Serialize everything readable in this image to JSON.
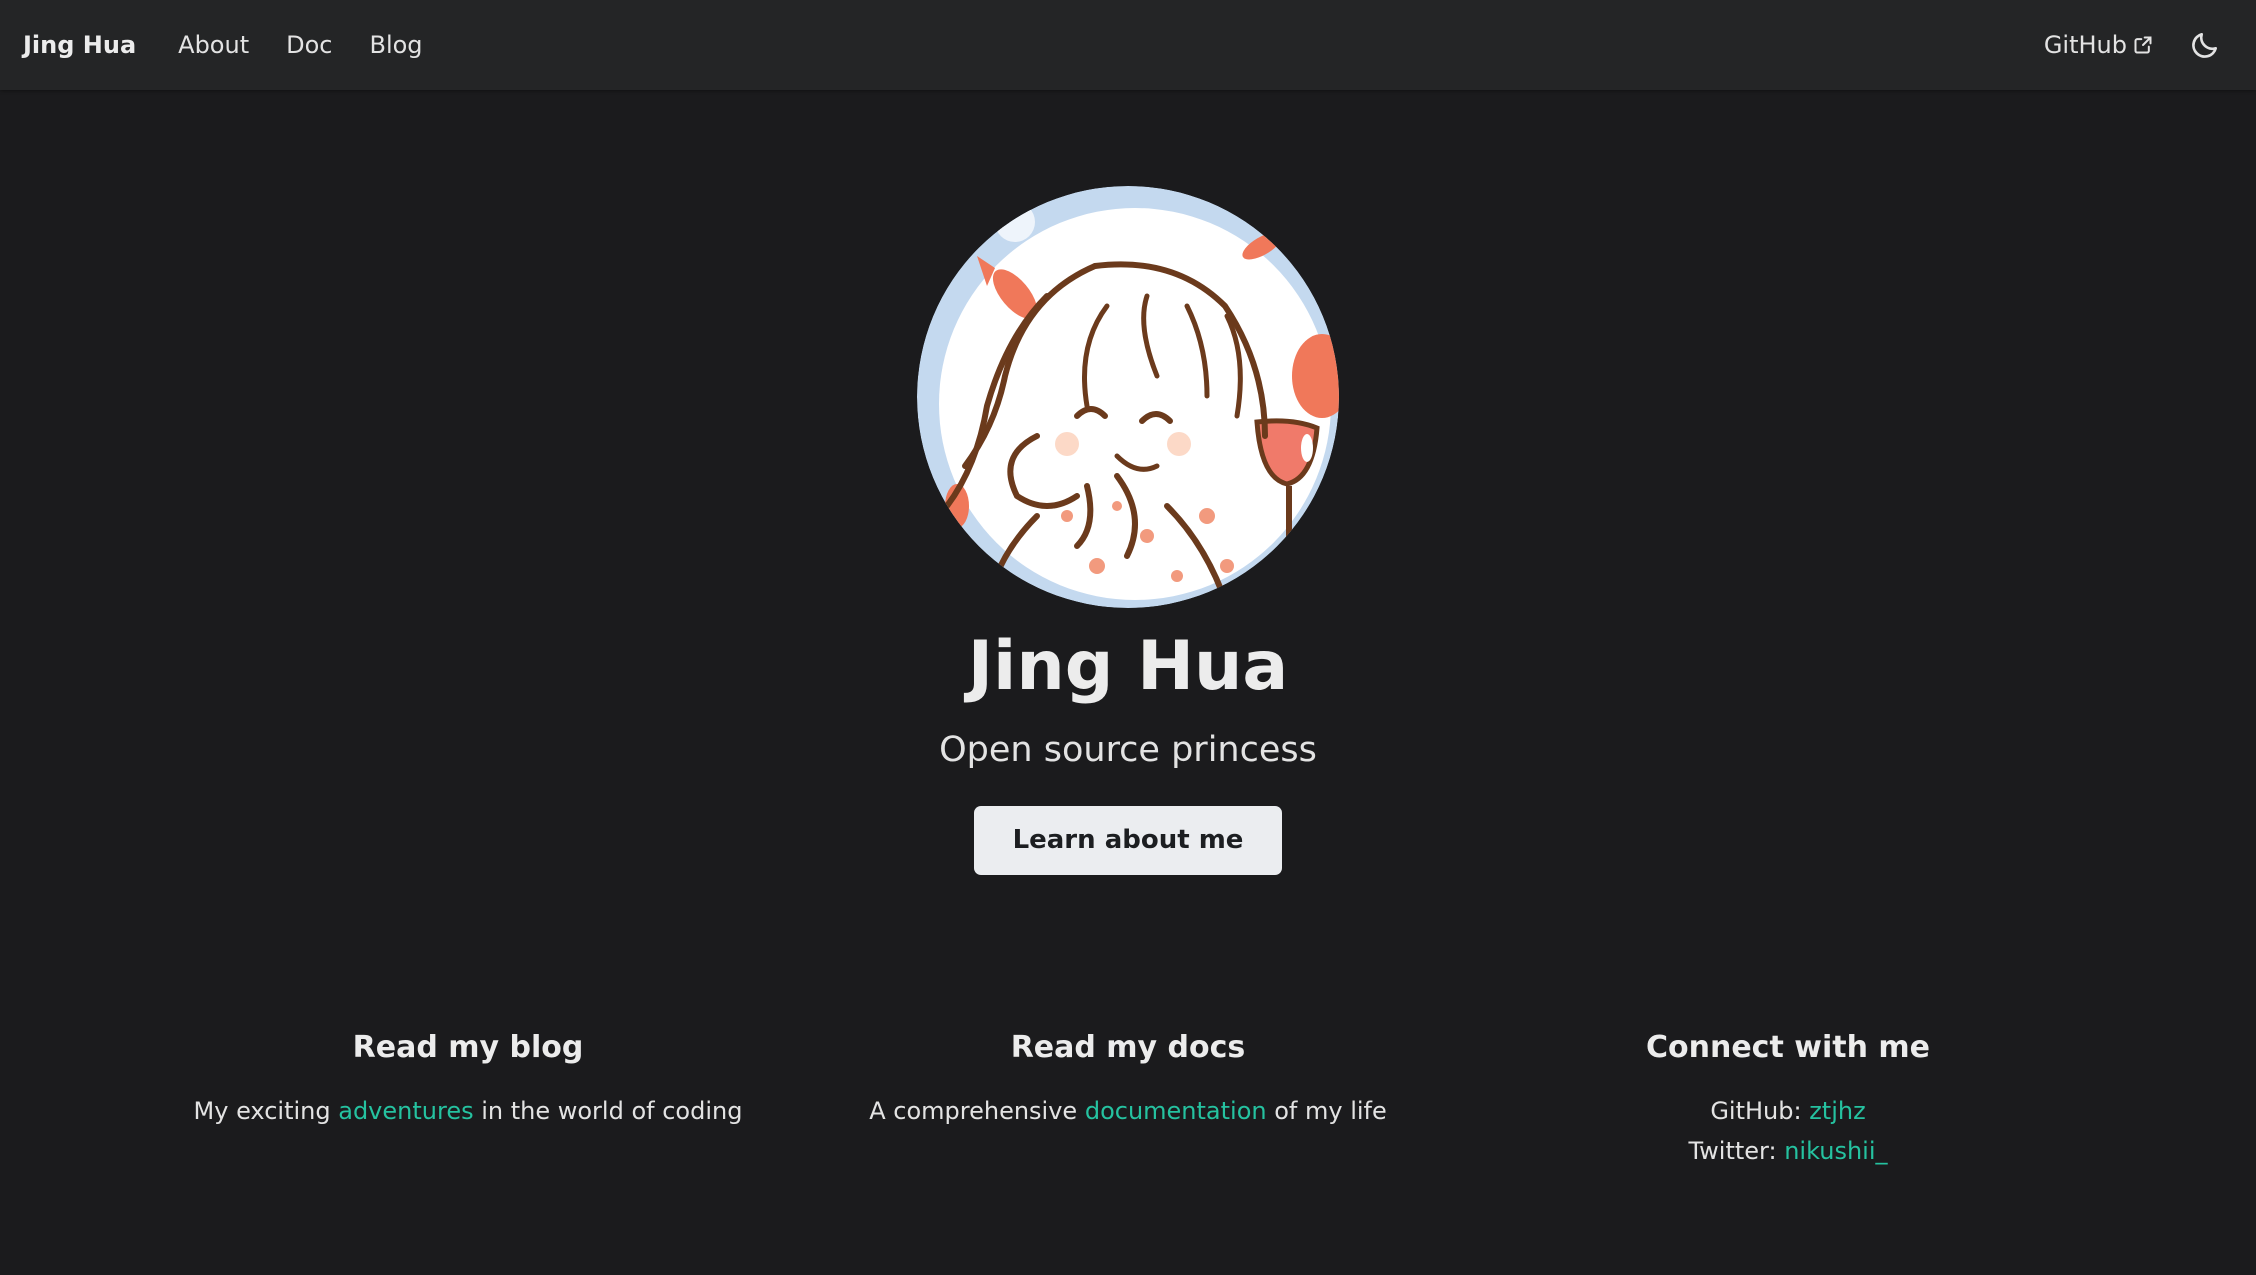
{
  "navbar": {
    "brand": "Jing Hua",
    "links": [
      "About",
      "Doc",
      "Blog"
    ],
    "github_label": "GitHub",
    "external_icon": "external-link-icon",
    "theme_icon": "moon-icon"
  },
  "hero": {
    "title": "Jing Hua",
    "subtitle": "Open source princess",
    "cta_label": "Learn about me"
  },
  "features": [
    {
      "heading": "Read my blog",
      "before": "My exciting ",
      "link": "adventures",
      "after": " in the world of coding"
    },
    {
      "heading": "Read my docs",
      "before": "A comprehensive ",
      "link": "documentation",
      "after": " of my life"
    },
    {
      "heading": "Connect with me",
      "github_label": "GitHub: ",
      "github_link": "ztjhz",
      "twitter_label": "Twitter: ",
      "twitter_link": "nikushii_"
    }
  ],
  "colors": {
    "background": "#1b1b1d",
    "navbar": "#242526",
    "accent": "#25c2a0",
    "button": "#ebedf0"
  }
}
